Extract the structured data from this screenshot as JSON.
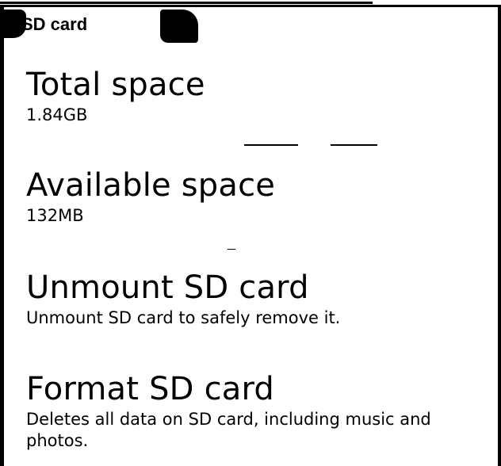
{
  "header": {
    "title": "SD card"
  },
  "items": [
    {
      "title": "Total space",
      "summary": "1.84GB"
    },
    {
      "title": "Available space",
      "summary": "132MB"
    },
    {
      "title": "Unmount SD card",
      "summary": "Unmount SD card to safely remove it."
    },
    {
      "title": "Format SD card",
      "summary": "Deletes all data on SD card, including music and photos."
    }
  ]
}
